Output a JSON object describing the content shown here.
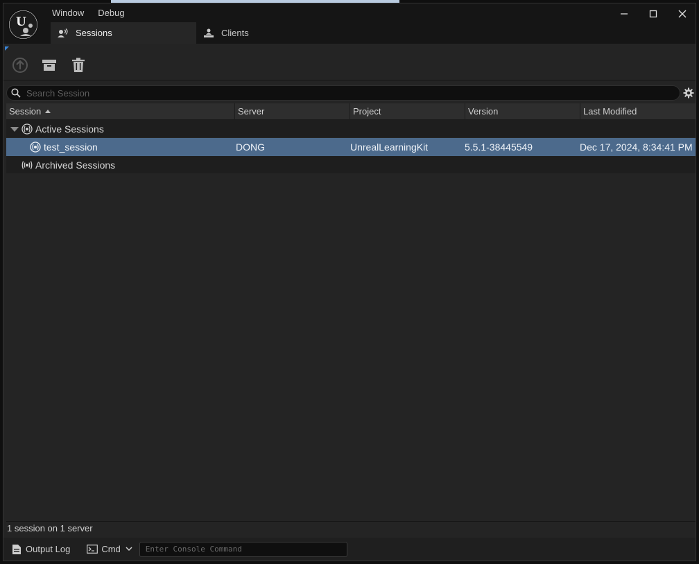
{
  "window": {
    "menu": [
      "Window",
      "Debug"
    ],
    "tabs": [
      {
        "label": "Sessions",
        "icon": "sessions-icon",
        "active": true
      },
      {
        "label": "Clients",
        "icon": "clients-icon",
        "active": false
      }
    ],
    "controls": [
      "minimize-icon",
      "maximize-icon",
      "close-icon"
    ]
  },
  "toolbar": {
    "buttons": [
      "restore-session-icon",
      "archive-session-icon",
      "delete-session-icon"
    ]
  },
  "search": {
    "placeholder": "Search Session"
  },
  "table": {
    "columns": [
      "Session",
      "Server",
      "Project",
      "Version",
      "Last Modified"
    ],
    "sort_column": "Session",
    "groups": [
      {
        "label": "Active Sessions",
        "expanded": true,
        "rows": [
          {
            "session": "test_session",
            "server": "DONG",
            "project": "UnrealLearningKit",
            "version": "5.5.1-38445549",
            "last_modified": "Dec 17, 2024, 8:34:41 PM",
            "selected": true
          }
        ]
      },
      {
        "label": "Archived Sessions",
        "expanded": false,
        "rows": []
      }
    ]
  },
  "status": {
    "text": "1 session on 1 server"
  },
  "footer": {
    "output_log": "Output Log",
    "cmd": "Cmd",
    "console_placeholder": "Enter Console Command"
  },
  "colors": {
    "selection": "#4c6a8c",
    "panel": "#242424",
    "accent": "#3a86d9"
  }
}
